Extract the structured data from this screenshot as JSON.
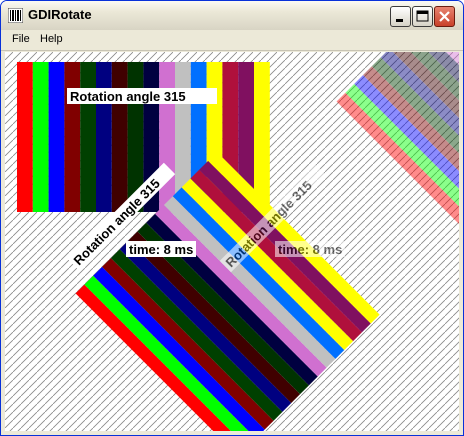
{
  "window": {
    "title": "GDIRotate",
    "app_icon": "barcode-icon",
    "controls": {
      "minimize": "minimize-icon",
      "maximize": "maximize-icon",
      "close": "close-icon"
    }
  },
  "menu": [
    {
      "label": "File"
    },
    {
      "label": "Help"
    }
  ],
  "canvas": {
    "background_pattern": "diagonal-hatch",
    "stripe_colors": [
      "#ff0000",
      "#00ff00",
      "#0000ff",
      "#800000",
      "#004000",
      "#000080",
      "#400000",
      "#003300",
      "#000040",
      "#d070d0",
      "#c0c0c0",
      "#0070ff",
      "#ffff00",
      "#b0103c",
      "#801060",
      "#ffff00"
    ],
    "labels": {
      "upright_angle": "Rotation angle 315",
      "rotated_angle": "Rotation angle 315",
      "rotated_time": "time: 8 ms",
      "faded_angle": "Rotation angle 315",
      "faded_time": "time: 8 ms"
    }
  }
}
